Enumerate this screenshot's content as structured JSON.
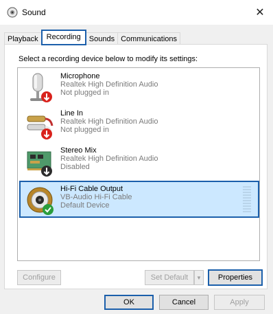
{
  "window": {
    "title": "Sound",
    "close_glyph": "✕"
  },
  "tabs": [
    {
      "label": "Playback"
    },
    {
      "label": "Recording"
    },
    {
      "label": "Sounds"
    },
    {
      "label": "Communications"
    }
  ],
  "instruction": "Select a recording device below to modify its settings:",
  "devices": [
    {
      "name": "Microphone",
      "driver": "Realtek High Definition Audio",
      "status": "Not plugged in",
      "icon": "microphone-icon"
    },
    {
      "name": "Line In",
      "driver": "Realtek High Definition Audio",
      "status": "Not plugged in",
      "icon": "line-in-icon"
    },
    {
      "name": "Stereo Mix",
      "driver": "Realtek High Definition Audio",
      "status": "Disabled",
      "icon": "sound-card-icon"
    },
    {
      "name": "Hi-Fi Cable Output",
      "driver": "VB-Audio Hi-Fi Cable",
      "status": "Default Device",
      "icon": "rca-jack-icon"
    }
  ],
  "buttons": {
    "configure": "Configure",
    "set_default": "Set Default",
    "properties": "Properties",
    "ok": "OK",
    "cancel": "Cancel",
    "apply": "Apply"
  },
  "colors": {
    "accent": "#1b5fab",
    "selection": "#cce8ff",
    "status_red": "#d9221c",
    "status_green": "#2a9d3c"
  }
}
